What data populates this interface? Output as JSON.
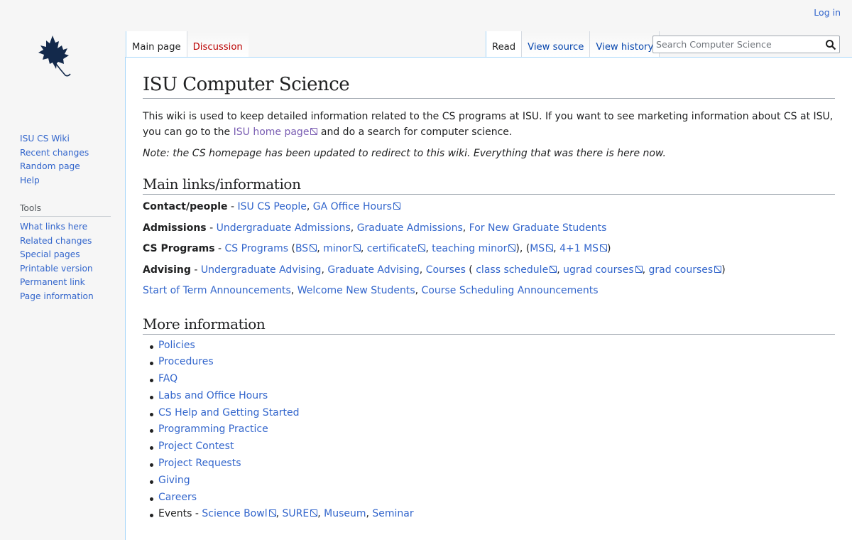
{
  "personal": {
    "login": "Log in"
  },
  "sidebar": {
    "nav": [
      "ISU CS Wiki",
      "Recent changes",
      "Random page",
      "Help"
    ],
    "tools_heading": "Tools",
    "tools": [
      "What links here",
      "Related changes",
      "Special pages",
      "Printable version",
      "Permanent link",
      "Page information"
    ]
  },
  "tabs": {
    "left": [
      "Main page",
      "Discussion"
    ],
    "right": [
      "Read",
      "View source",
      "View history"
    ]
  },
  "search": {
    "placeholder": "Search Computer Science"
  },
  "page": {
    "title": "ISU Computer Science",
    "intro_1": "This wiki is used to keep detailed information related to the CS programs at ISU. If you want to see marketing information about CS at ISU, you can go to the",
    "intro_link": "ISU home page",
    "intro_2": "and do a search for computer science.",
    "note": "Note: the CS homepage has been updated to redirect to this wiki. Everything that was there is here now.",
    "main_heading": "Main links/information",
    "contact": {
      "label": "Contact/people",
      "sep": " - ",
      "links": [
        "ISU CS People",
        "GA Office Hours"
      ]
    },
    "admissions": {
      "label": "Admissions",
      "sep": " - ",
      "links": [
        "Undergraduate Admissions",
        "Graduate Admissions",
        "For New Graduate Students"
      ]
    },
    "programs": {
      "label": "CS Programs",
      "sep": " - ",
      "main_link": "CS Programs",
      "bs": "BS",
      "minor": "minor",
      "certificate": "certificate",
      "teaching_minor": "teaching minor",
      "ms": "MS",
      "ms41": "4+1 MS"
    },
    "advising": {
      "label": "Advising",
      "sep": " - ",
      "links": [
        "Undergraduate Advising",
        "Graduate Advising",
        "Courses"
      ],
      "class_schedule": "class schedule",
      "ugrad_courses": "ugrad courses",
      "grad_courses": "grad courses"
    },
    "announcements": [
      "Start of Term Announcements",
      "Welcome New Students",
      "Course Scheduling Announcements"
    ],
    "more_heading": "More information",
    "more": [
      "Policies",
      "Procedures",
      "FAQ",
      "Labs and Office Hours",
      "CS Help and Getting Started",
      "Programming Practice",
      "Project Contest",
      "Project Requests",
      "Giving",
      "Careers"
    ],
    "events": {
      "label": "Events",
      "sep": " - ",
      "science_bowl": "Science Bowl",
      "sure": "SURE",
      "museum": "Museum",
      "seminar": "Seminar"
    }
  },
  "colors": {
    "link": "#3366cc",
    "visited": "#795cb2",
    "logo": "#13294b"
  },
  "icons": {
    "logo": "maple-leaf-icon",
    "search": "search-icon",
    "external": "external-link-icon"
  }
}
